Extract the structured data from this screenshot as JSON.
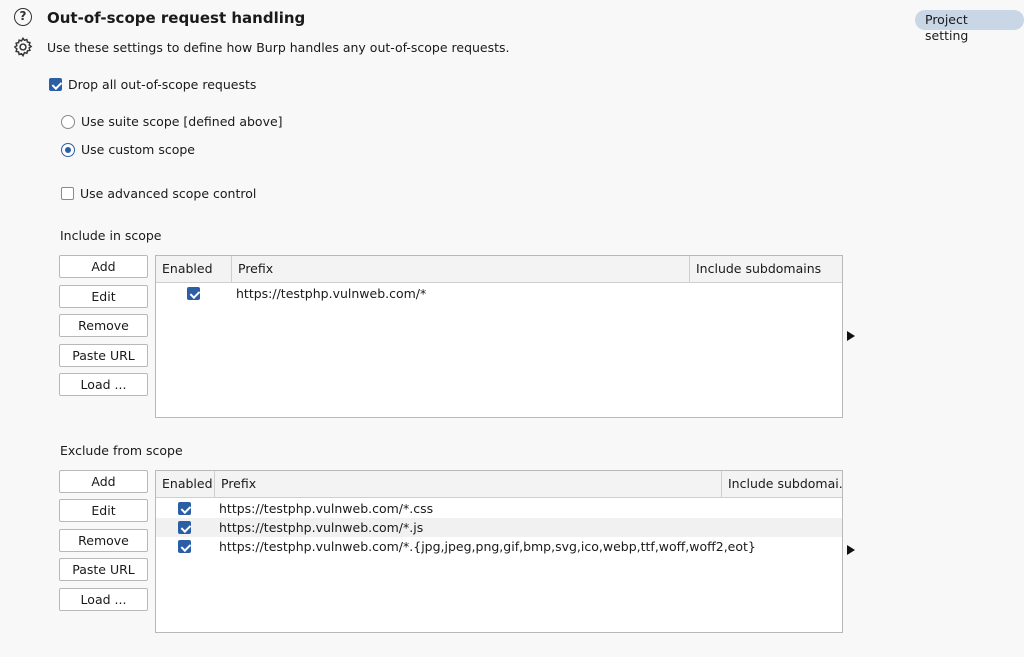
{
  "header": {
    "title": "Out-of-scope request handling",
    "description": "Use these settings to define how Burp handles any out-of-scope requests.",
    "badge": "Project setting"
  },
  "options": {
    "drop_all": {
      "label": "Drop all out-of-scope requests",
      "checked": true
    },
    "suite_scope": {
      "label": "Use suite scope [defined above]",
      "selected": false
    },
    "custom_scope": {
      "label": "Use custom scope",
      "selected": true
    },
    "advanced": {
      "label": "Use advanced scope control",
      "checked": false
    }
  },
  "include": {
    "label": "Include in scope",
    "buttons": [
      "Add",
      "Edit",
      "Remove",
      "Paste URL",
      "Load ..."
    ],
    "columns": [
      "Enabled",
      "Prefix",
      "Include subdomains"
    ],
    "rows": [
      {
        "enabled": true,
        "prefix": "https://testphp.vulnweb.com/*",
        "subdomains": ""
      }
    ]
  },
  "exclude": {
    "label": "Exclude from scope",
    "buttons": [
      "Add",
      "Edit",
      "Remove",
      "Paste URL",
      "Load ..."
    ],
    "columns": [
      "Enabled",
      "Prefix",
      "Include subdomai..."
    ],
    "rows": [
      {
        "enabled": true,
        "prefix": "https://testphp.vulnweb.com/*.css",
        "subdomains": ""
      },
      {
        "enabled": true,
        "prefix": "https://testphp.vulnweb.com/*.js",
        "subdomains": ""
      },
      {
        "enabled": true,
        "prefix": "https://testphp.vulnweb.com/*.{jpg,jpeg,png,gif,bmp,svg,ico,webp,ttf,woff,woff2,eot}",
        "subdomains": ""
      }
    ]
  }
}
